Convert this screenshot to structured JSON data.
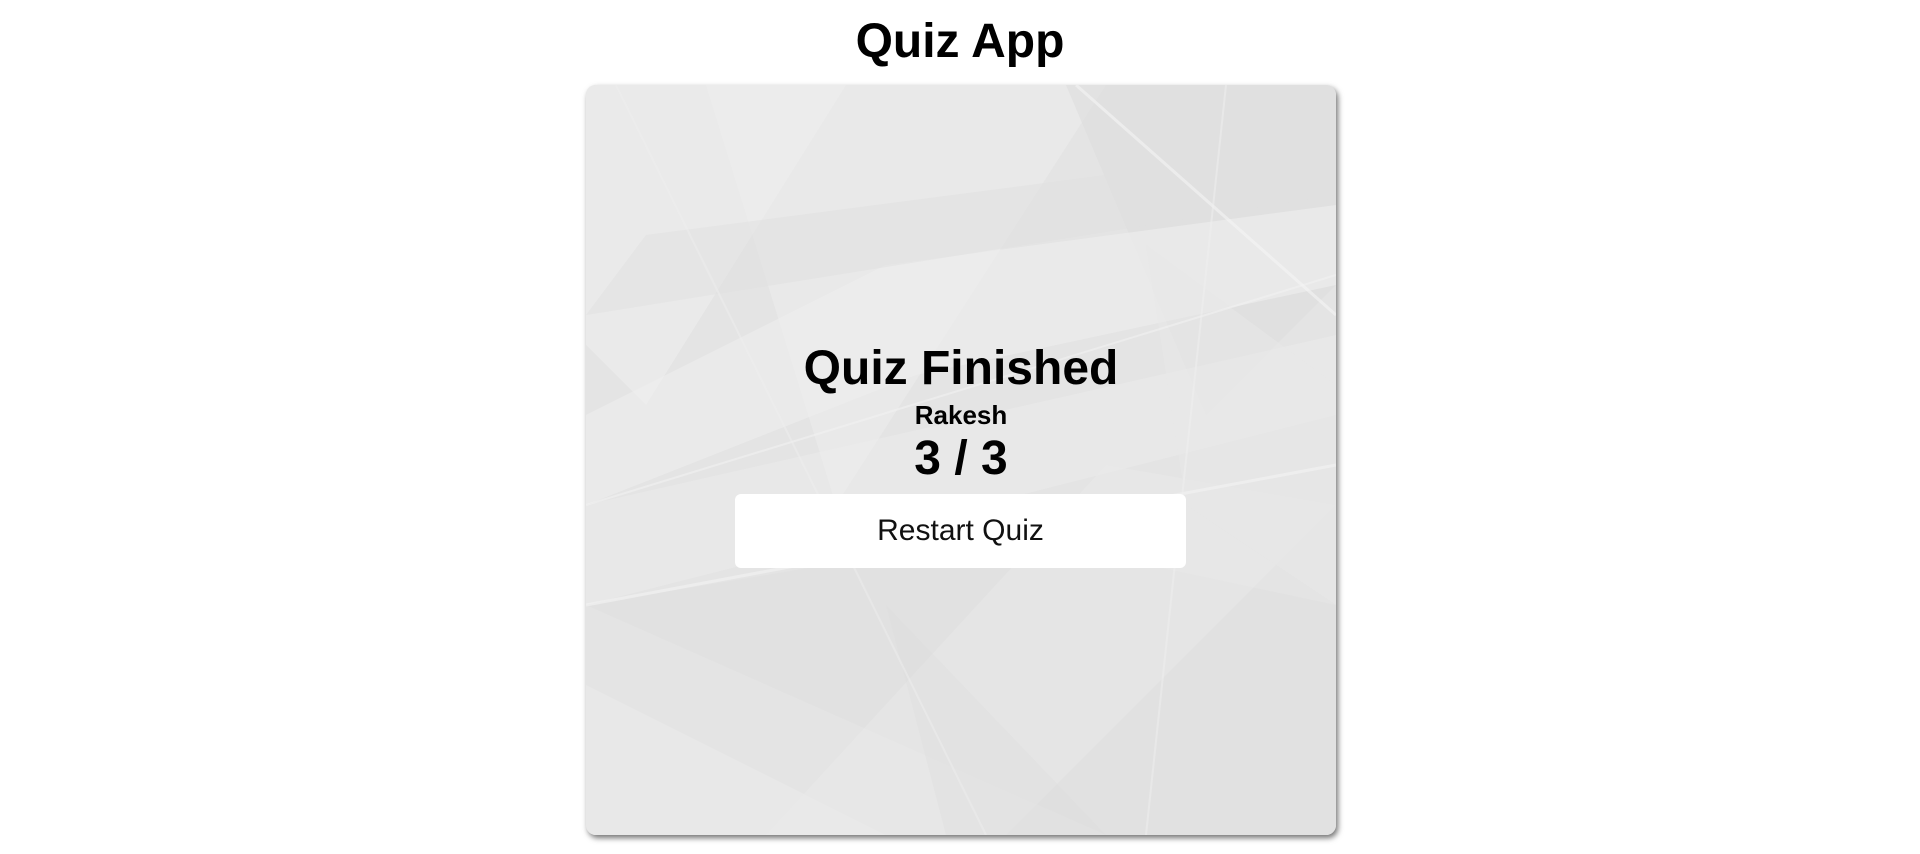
{
  "app": {
    "title": "Quiz App"
  },
  "result": {
    "heading": "Quiz Finished",
    "player_name": "Rakesh",
    "score_text": "3 / 3",
    "score": 3,
    "total": 3
  },
  "actions": {
    "restart_label": "Restart Quiz"
  },
  "colors": {
    "page_background": "#ffffff",
    "card_background": "#e6e6e6",
    "button_background": "#ffffff",
    "text": "#000000"
  }
}
